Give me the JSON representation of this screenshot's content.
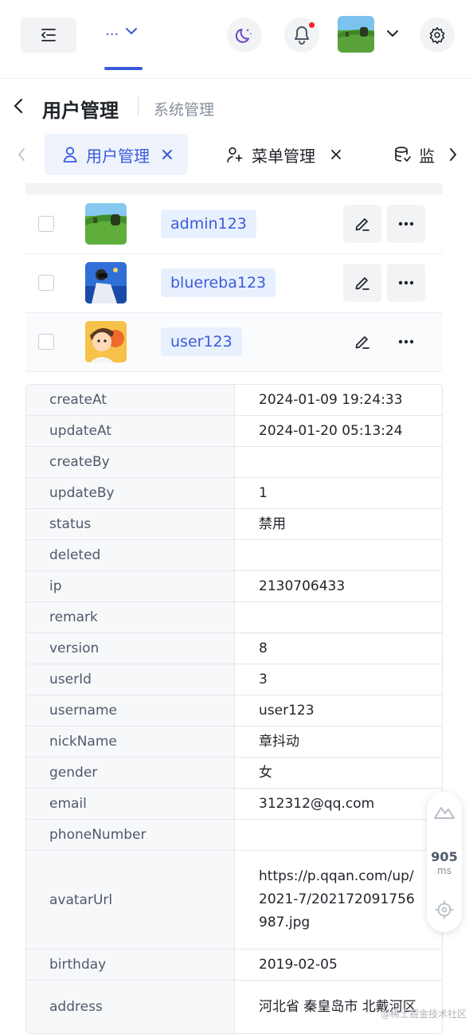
{
  "header": {
    "breadcrumb_more": "...",
    "colors": {
      "accent": "#3b5bdb",
      "notification_dot": "#f5222d"
    }
  },
  "page": {
    "title": "用户管理",
    "subtitle": "系统管理"
  },
  "tabs": [
    {
      "label": "用户管理",
      "icon": "user-icon",
      "active": true
    },
    {
      "label": "菜单管理",
      "icon": "user-plus-icon",
      "active": false
    },
    {
      "label": "监",
      "icon": "database-icon",
      "active": false
    }
  ],
  "users": [
    {
      "username": "admin123",
      "avatar": "landscape-avatar"
    },
    {
      "username": "bluereba123",
      "avatar": "photographer-avatar"
    },
    {
      "username": "user123",
      "avatar": "cartoon-boy-avatar",
      "expanded": true
    }
  ],
  "detail": [
    {
      "label": "createAt",
      "value": "2024-01-09 19:24:33"
    },
    {
      "label": "updateAt",
      "value": "2024-01-20 05:13:24"
    },
    {
      "label": "createBy",
      "value": ""
    },
    {
      "label": "updateBy",
      "value": "1"
    },
    {
      "label": "status",
      "value": "禁用"
    },
    {
      "label": "deleted",
      "value": ""
    },
    {
      "label": "ip",
      "value": "2130706433"
    },
    {
      "label": "remark",
      "value": ""
    },
    {
      "label": "version",
      "value": "8"
    },
    {
      "label": "userId",
      "value": "3"
    },
    {
      "label": "username",
      "value": "user123"
    },
    {
      "label": "nickName",
      "value": "章抖动"
    },
    {
      "label": "gender",
      "value": "女"
    },
    {
      "label": "email",
      "value": "312312@qq.com"
    },
    {
      "label": "phoneNumber",
      "value": ""
    },
    {
      "label": "avatarUrl",
      "value": "https://p.qqan.com/up/2021-7/20217209175698​7.jpg"
    },
    {
      "label": "birthday",
      "value": "2019-02-05"
    },
    {
      "label": "address",
      "value": "河北省 秦皇岛市 北戴河区"
    }
  ],
  "monitor": {
    "value": "905",
    "unit": "ms"
  },
  "watermark": "@稀土掘金技术社区"
}
